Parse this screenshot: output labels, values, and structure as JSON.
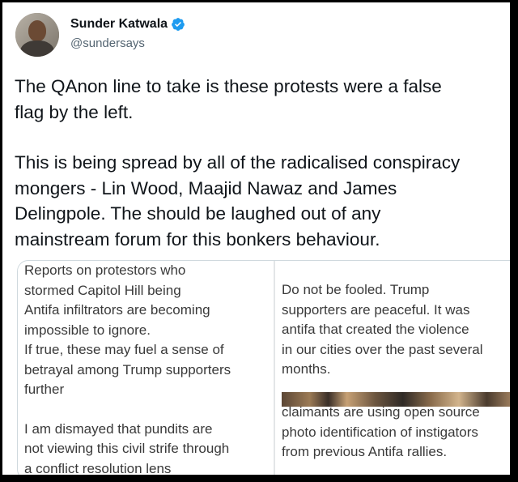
{
  "tweet": {
    "author_name": "Sunder Katwala",
    "handle": "@sundersays",
    "verified_color": "#1d9bf0",
    "paragraph1_lines": [
      "The QAnon line to take is these protests were a false",
      "flag by the left."
    ],
    "paragraph2_lines": [
      "This is being spread by all of the radicalised conspiracy",
      "mongers - Lin Wood, Maajid Nawaz and James",
      "Delingpole. The should be laughed out of any",
      "mainstream forum for this bonkers behaviour."
    ]
  },
  "media": {
    "left": {
      "lines1": [
        "Reports on protestors who",
        "stormed Capitol Hill being",
        "Antifa infiltrators are becoming",
        "impossible to ignore.",
        "If true, these may fuel a sense of",
        "betrayal among Trump supporters",
        "further"
      ],
      "lines2": [
        "I am dismayed that pundits are",
        "not viewing this civil strife through",
        "a conflict resolution lens"
      ]
    },
    "right": {
      "lines1": [
        "Do not be fooled. Trump",
        "supporters are peaceful. It was",
        "antifa that created the violence",
        "in our cities over the past several",
        "months."
      ],
      "lines2": [
        "claimants are using open source",
        "photo identification of instigators",
        "from previous Antifa rallies."
      ]
    }
  }
}
